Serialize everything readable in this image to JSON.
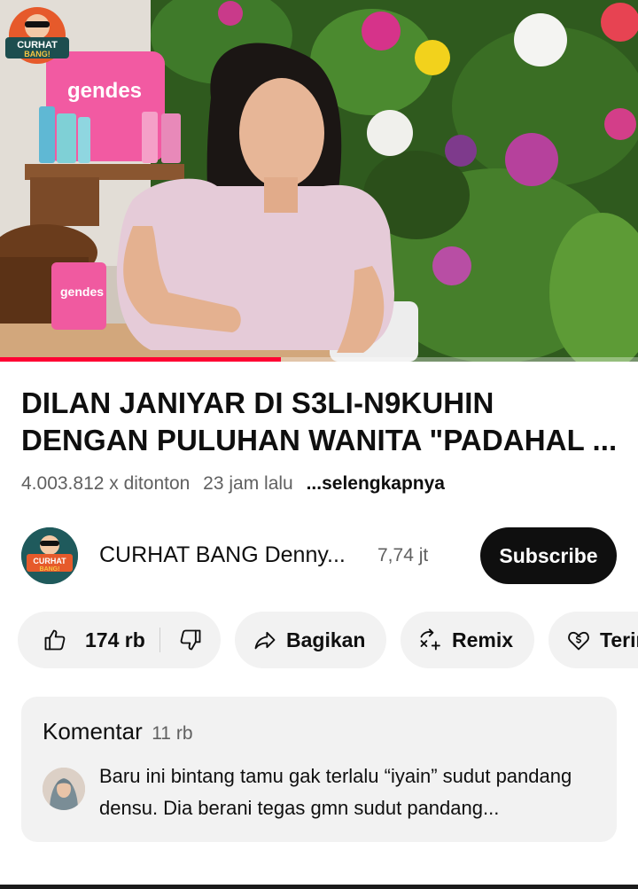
{
  "player": {
    "progress_fraction": 0.44,
    "progress_color": "#ff0033",
    "overlay_logo_text": "CURHAT BANG!",
    "scene_text": {
      "pillow_brand": "gendes",
      "mug_brand": "gendes"
    }
  },
  "video": {
    "title": "DILAN JANIYAR DI S3LI-N9KUHIN DENGAN PULUHAN WANITA \"PADAHAL ...",
    "views": "4.003.812 x ditonton",
    "age": "23 jam lalu",
    "more_label": "...selengkapnya"
  },
  "channel": {
    "name": "CURHAT BANG Denny...",
    "subscribers": "7,74 jt",
    "subscribe_label": "Subscribe",
    "avatar_text": "CURHAT BANG!"
  },
  "actions": {
    "like_count": "174 rb",
    "share_label": "Bagikan",
    "remix_label": "Remix",
    "thanks_label": "Terima kasih"
  },
  "comments": {
    "title": "Komentar",
    "count": "11 rb",
    "top_comment": "Baru ini bintang tamu gak terlalu “iyain” sudut pandang densu. Dia berani tegas gmn sudut pandang..."
  },
  "icons": {
    "like": "thumbs-up-icon",
    "dislike": "thumbs-down-icon",
    "share": "share-arrow-icon",
    "remix": "remix-icon",
    "thanks": "heart-dollar-icon"
  }
}
